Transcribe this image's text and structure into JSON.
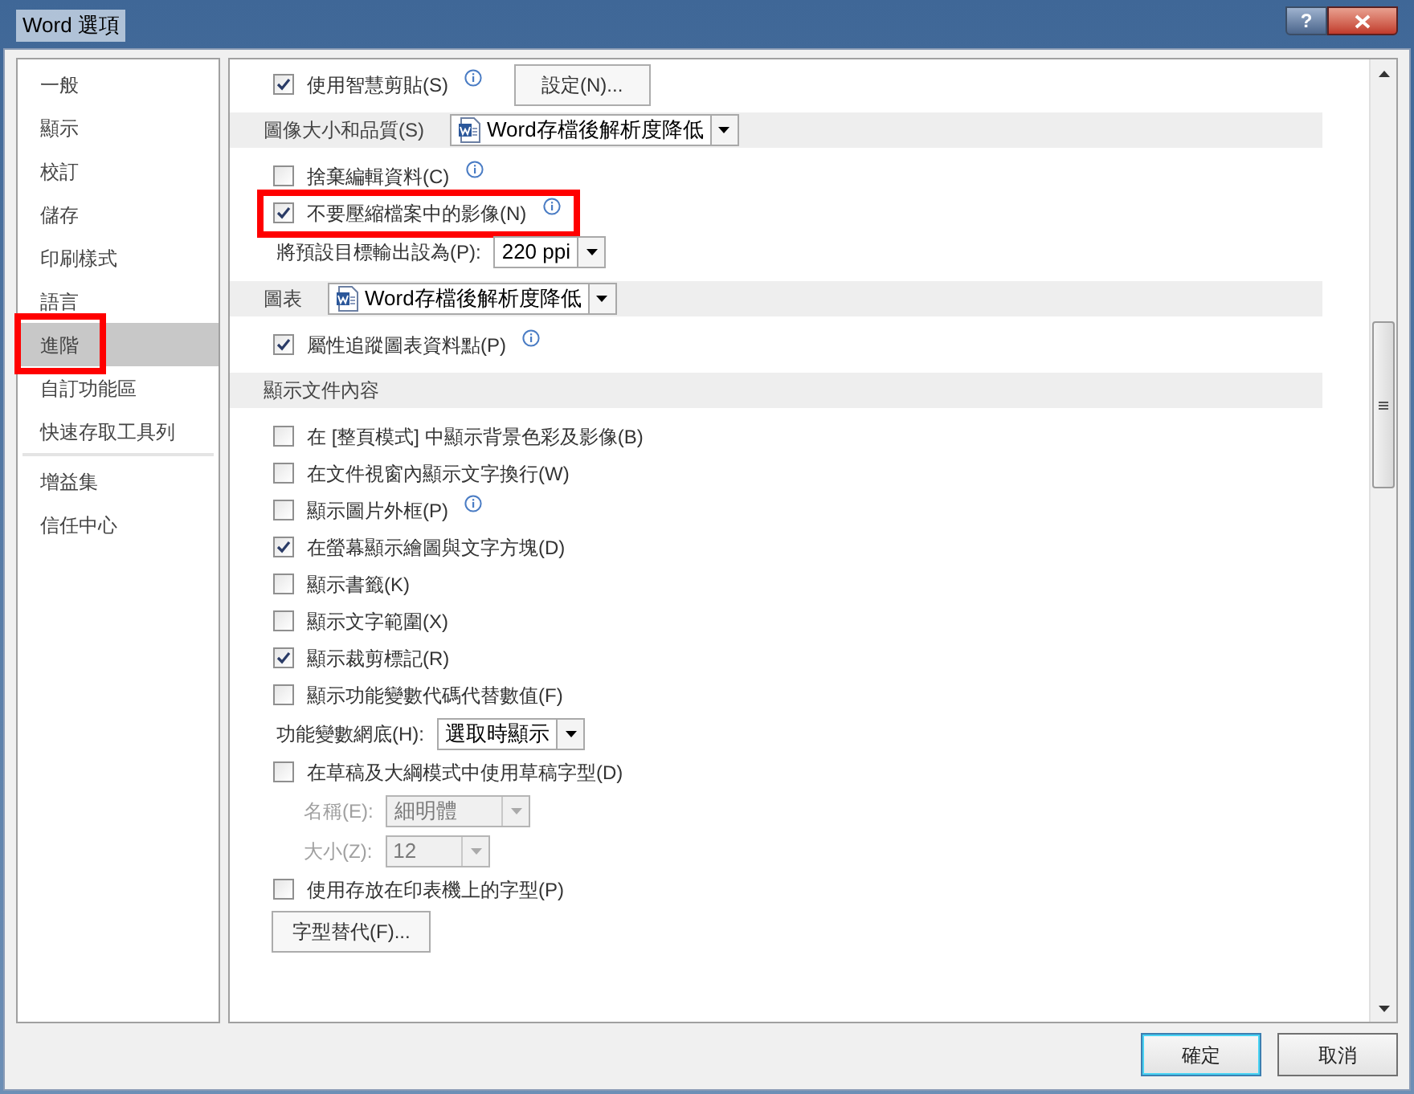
{
  "window": {
    "title": "Word 選項",
    "help_button": "?"
  },
  "sidebar": {
    "groups": [
      [
        {
          "label": "一般",
          "selected": false,
          "highlighted": false
        },
        {
          "label": "顯示",
          "selected": false,
          "highlighted": false
        },
        {
          "label": "校訂",
          "selected": false,
          "highlighted": false
        },
        {
          "label": "儲存",
          "selected": false,
          "highlighted": false
        },
        {
          "label": "印刷樣式",
          "selected": false,
          "highlighted": false
        },
        {
          "label": "語言",
          "selected": false,
          "highlighted": false
        },
        {
          "label": "進階",
          "selected": true,
          "highlighted": true
        },
        {
          "label": "自訂功能區",
          "selected": false,
          "highlighted": false
        },
        {
          "label": "快速存取工具列",
          "selected": false,
          "highlighted": false
        }
      ],
      [
        {
          "label": "增益集",
          "selected": false,
          "highlighted": false
        },
        {
          "label": "信任中心",
          "selected": false,
          "highlighted": false
        }
      ]
    ]
  },
  "content": {
    "rows": [
      {
        "kind": "checkbox",
        "label": "使用智慧剪貼(S)",
        "checked": true,
        "info": true,
        "highlighted": false,
        "button": "設定(N)..."
      },
      {
        "kind": "header",
        "label": "圖像大小和品質(S)",
        "select": {
          "value": "Word存檔後解析度降低",
          "doc_icon": true
        }
      },
      {
        "kind": "checkbox",
        "label": "捨棄編輯資料(C)",
        "checked": false,
        "info": true,
        "highlighted": false
      },
      {
        "kind": "checkbox",
        "label": "不要壓縮檔案中的影像(N)",
        "checked": true,
        "info": true,
        "highlighted": true
      },
      {
        "kind": "select",
        "label": "將預設目標輸出設為(P):",
        "value": "220 ppi",
        "disabled": false,
        "indent": false
      },
      {
        "kind": "header",
        "label": "圖表",
        "select": {
          "value": "Word存檔後解析度降低",
          "doc_icon": true
        }
      },
      {
        "kind": "checkbox",
        "label": "屬性追蹤圖表資料點(P)",
        "checked": true,
        "info": true,
        "highlighted": false
      },
      {
        "kind": "header",
        "label": "顯示文件內容"
      },
      {
        "kind": "checkbox",
        "label": "在 [整頁模式] 中顯示背景色彩及影像(B)",
        "checked": false,
        "info": false,
        "highlighted": false
      },
      {
        "kind": "checkbox",
        "label": "在文件視窗內顯示文字換行(W)",
        "checked": false,
        "info": false,
        "highlighted": false
      },
      {
        "kind": "checkbox",
        "label": "顯示圖片外框(P)",
        "checked": false,
        "info": true,
        "highlighted": false
      },
      {
        "kind": "checkbox",
        "label": "在螢幕顯示繪圖與文字方塊(D)",
        "checked": true,
        "info": false,
        "highlighted": false
      },
      {
        "kind": "checkbox",
        "label": "顯示書籤(K)",
        "checked": false,
        "info": false,
        "highlighted": false
      },
      {
        "kind": "checkbox",
        "label": "顯示文字範圍(X)",
        "checked": false,
        "info": false,
        "highlighted": false
      },
      {
        "kind": "checkbox",
        "label": "顯示裁剪標記(R)",
        "checked": true,
        "info": false,
        "highlighted": false
      },
      {
        "kind": "checkbox",
        "label": "顯示功能變數代碼代替數值(F)",
        "checked": false,
        "info": false,
        "highlighted": false
      },
      {
        "kind": "select",
        "label": "功能變數網底(H):",
        "value": "選取時顯示",
        "disabled": false,
        "indent": false
      },
      {
        "kind": "checkbox",
        "label": "在草稿及大綱模式中使用草稿字型(D)",
        "checked": false,
        "info": false,
        "highlighted": false
      },
      {
        "kind": "select",
        "label": "名稱(E):",
        "value": "細明體",
        "disabled": true,
        "indent": true
      },
      {
        "kind": "select",
        "label": "大小(Z):",
        "value": "12",
        "disabled": true,
        "indent": true
      },
      {
        "kind": "checkbox",
        "label": "使用存放在印表機上的字型(P)",
        "checked": false,
        "info": false,
        "highlighted": false
      },
      {
        "kind": "button",
        "label": "字型替代(F)..."
      }
    ]
  },
  "footer": {
    "buttons": [
      "確定",
      "取消"
    ]
  }
}
